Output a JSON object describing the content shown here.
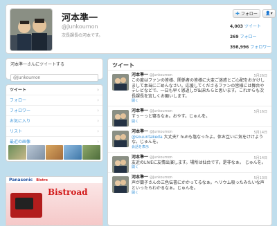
{
  "profile": {
    "name": "河本準一",
    "handle": "@Junkoumon",
    "bio": "次長課長の河本です。",
    "follow_label": "フォロー",
    "user_menu_label": "▾",
    "stats": [
      {
        "value": "4,003",
        "label": "ツイート"
      },
      {
        "value": "269",
        "label": "フォロー"
      },
      {
        "value": "398,996",
        "label": "フォロワー"
      }
    ]
  },
  "compose": {
    "title": "河本準一さんにツイートする",
    "placeholder": "@Junkoumon"
  },
  "nav": {
    "items": [
      {
        "label": "ツイート"
      },
      {
        "label": "フォロー"
      },
      {
        "label": "フォロワー"
      },
      {
        "label": "お気に入り"
      },
      {
        "label": "リスト"
      },
      {
        "label": "最近の画像"
      }
    ]
  },
  "ad": {
    "brand": "Panasonic",
    "sub": "Bistro",
    "title": "Bistroad"
  },
  "timeline": {
    "title": "ツイート",
    "tweets": [
      {
        "name": "河本準一",
        "handle": "@Junkoumon",
        "date": "5月26日",
        "text": "この度はファンの皆様、関係者の皆様に大変ご迷惑とご心配をおかけしまして本当にごめんなさい。応援してくださるファンの皆様には舞台やテレビなどで、一日も早く恩返しが出来たらと思います。これからも次長課長を宜しくお願いします。",
        "link": "開く"
      },
      {
        "name": "河本準一",
        "handle": "@Junkoumon",
        "date": "5月16日",
        "text": "すぅーっと寝るなぁ。おやす。じゅんを。",
        "link": "開く"
      },
      {
        "name": "河本準一",
        "handle": "@Junkoumon",
        "date": "5月14日",
        "mention": "@souuntakeda",
        "text": "大丈夫？huhも塩なったよ。体お互いに気をけけような。じゅんを。",
        "link": "会話を表示"
      },
      {
        "name": "河本準一",
        "handle": "@Junkoumon",
        "date": "5月14日",
        "text": "友近のLIVEに友情出演します。場所は仙台です。是非なぁ。 じゅんを。",
        "link": "開く"
      },
      {
        "name": "河本準一",
        "handle": "@Junkoumon",
        "date": "5月13日",
        "text": "声が蘭子さんの三色伝書にかかってるなぁ。ヘリウム吸ったみたいな声といったらわかるなぁ。じゅんを。",
        "link": "開く"
      }
    ]
  }
}
